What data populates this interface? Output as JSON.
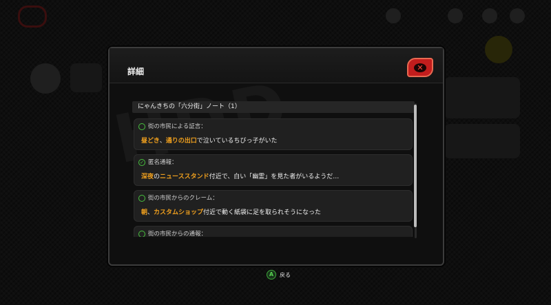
{
  "modal": {
    "title": "詳細",
    "close_icon": "close-icon",
    "list_header": "にゃんきちの「六分街」ノート（1）",
    "entries": [
      {
        "title": "街の市民による証言：",
        "checked": false,
        "text": [
          {
            "t": "昼どき",
            "hl": true
          },
          {
            "t": "、",
            "hl": false
          },
          {
            "t": "通りの出口",
            "hl": true
          },
          {
            "t": "で泣いているちびっ子がいた",
            "hl": false
          }
        ]
      },
      {
        "title": "匿名通報：",
        "checked": true,
        "text": [
          {
            "t": "深夜",
            "hl": true
          },
          {
            "t": "の",
            "hl": false
          },
          {
            "t": "ニューススタンド",
            "hl": true
          },
          {
            "t": "付近で、白い「幽霊」を見た者がいるようだ…",
            "hl": false
          }
        ]
      },
      {
        "title": "街の市民からのクレーム：",
        "checked": false,
        "text": [
          {
            "t": "朝",
            "hl": true
          },
          {
            "t": "、",
            "hl": false
          },
          {
            "t": "カスタムショップ",
            "hl": true
          },
          {
            "t": "付近で動く紙袋に足を取られそうになった",
            "hl": false
          }
        ]
      },
      {
        "title": "街の市民からの通報：",
        "checked": false,
        "text": []
      }
    ]
  },
  "footer": {
    "button_glyph": "A",
    "label": "戻る"
  },
  "colors": {
    "accent_orange": "#f0a01e",
    "check_green": "#48c23e",
    "close_red": "#c21d1d"
  }
}
